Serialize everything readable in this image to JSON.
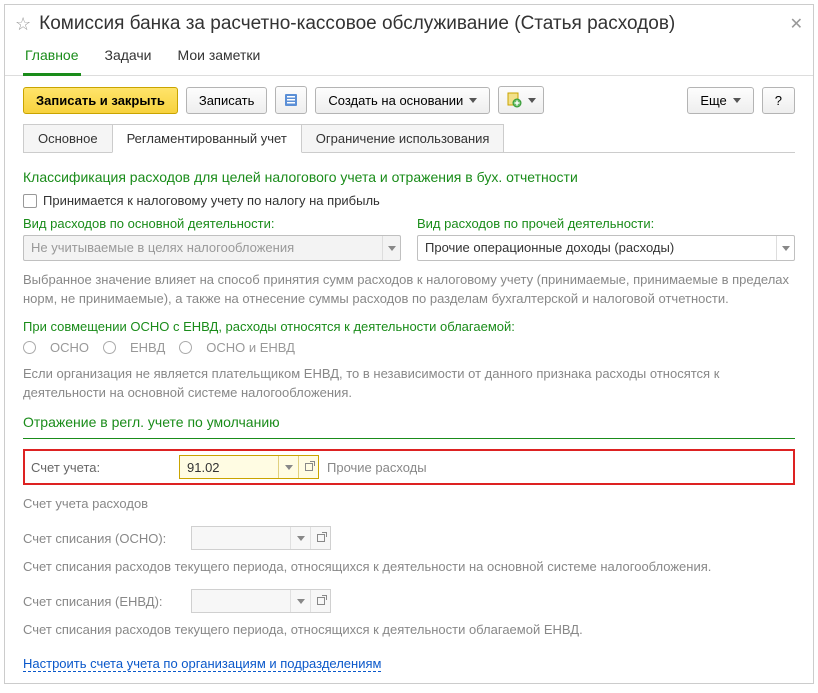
{
  "window": {
    "title": "Комиссия банка за расчетно-кассовое обслуживание (Статья расходов)"
  },
  "nav": {
    "main": "Главное",
    "tasks": "Задачи",
    "notes": "Мои заметки"
  },
  "toolbar": {
    "save_close": "Записать и закрыть",
    "save": "Записать",
    "create_from": "Создать на основании",
    "more": "Еще",
    "help": "?"
  },
  "subtabs": {
    "basic": "Основное",
    "regl": "Регламентированный учет",
    "limit": "Ограничение использования"
  },
  "sections": {
    "classification_title": "Классификация расходов для целей налогового учета и отражения в бух. отчетности",
    "checkbox_tax": "Принимается к налоговому учету по налогу на прибыль",
    "col1_label": "Вид расходов по основной деятельности:",
    "col1_value": "Не учитываемые в целях налогообложения",
    "col2_label": "Вид расходов по прочей деятельности:",
    "col2_value": "Прочие операционные доходы (расходы)",
    "desc1": "Выбранное значение влияет на способ принятия сумм расходов к налоговому учету (принимаемые, принимаемые в пределах норм, не принимаемые), а также на отнесение суммы расходов по разделам бухгалтерской и налоговой отчетности.",
    "combining_label": "При совмещении ОСНО с ЕНВД, расходы относятся к деятельности облагаемой:",
    "radio1": "ОСНО",
    "radio2": "ЕНВД",
    "radio3": "ОСНО и ЕНВД",
    "desc2": "Если организация не является плательщиком ЕНВД, то в независимости от данного признака расходы относятся к деятельности на основной системе налогообложения.",
    "regl_title": "Отражение в регл. учете по умолчанию",
    "account_label": "Счет учета:",
    "account_value": "91.02",
    "account_desc": "Прочие расходы",
    "account_expense_label": "Счет учета расходов",
    "writeoff_osno_label": "Счет списания (ОСНО):",
    "writeoff_osno_desc": "Счет списания расходов текущего периода, относящихся к деятельности на основной системе налогообложения.",
    "writeoff_envd_label": "Счет списания (ЕНВД):",
    "writeoff_envd_desc": "Счет списания расходов текущего периода, относящихся к деятельности облагаемой ЕНВД.",
    "link": "Настроить счета учета по организациям и подразделениям"
  }
}
